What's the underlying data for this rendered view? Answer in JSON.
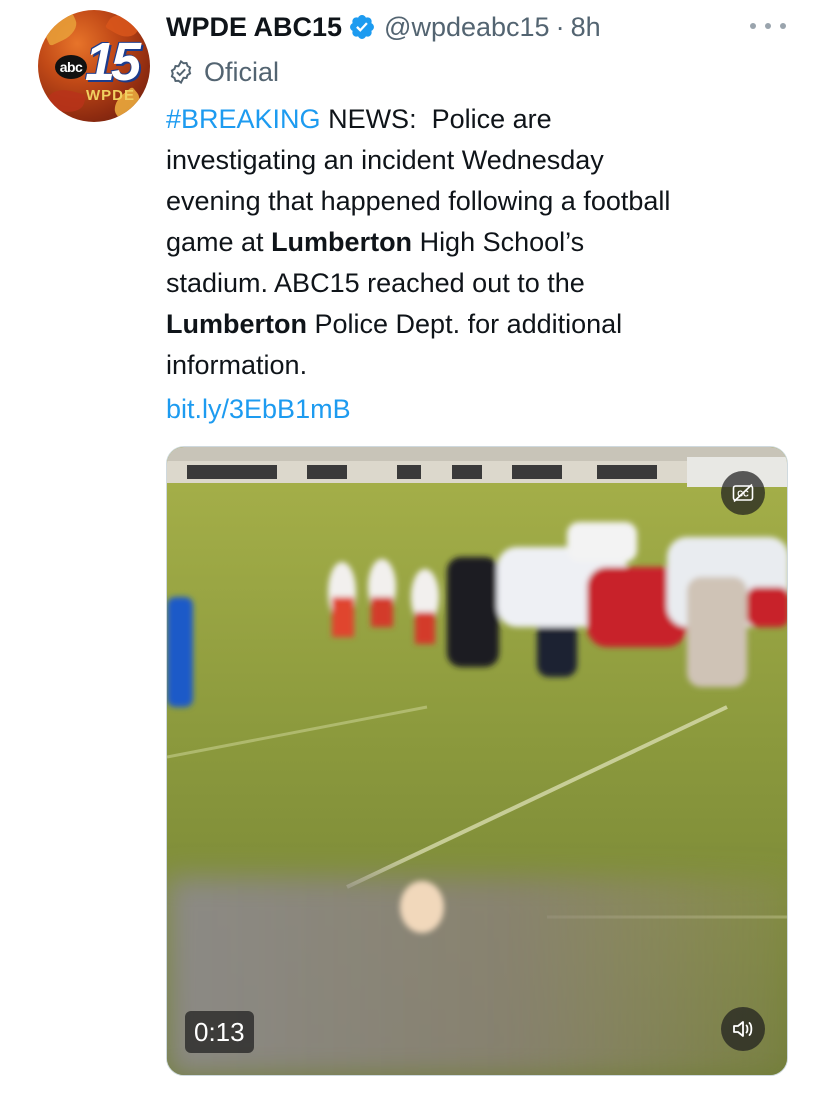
{
  "colors": {
    "text_primary": "#0f1419",
    "text_secondary": "#536471",
    "link": "#1d9bf0",
    "verified_badge": "#1d9bf0"
  },
  "author": {
    "avatar_logo_abc": "abc",
    "avatar_logo_number": "15",
    "avatar_logo_call": "WPDE",
    "display_name": "WPDE ABC15",
    "verified_icon": "verified-badge-icon",
    "handle": "@wpdeabc15",
    "separator": "·",
    "time_ago": "8h",
    "label_icon": "official-check-icon",
    "label": "Oficial"
  },
  "more_menu_icon": "more-dots-icon",
  "tweet": {
    "line1": {
      "hashtag": "#BREAKING",
      "rest": " NEWS:  Police are"
    },
    "line2": "investigating an incident Wednesday",
    "line3": "evening that happened following a football",
    "line4": {
      "before": "game at ",
      "bold": "Lumberton",
      "after": " High School’s"
    },
    "line5": "stadium. ABC15 reached out to the",
    "line6": {
      "bold": "Lumberton",
      "after": " Police Dept. for additional"
    },
    "line7": "information.",
    "short_link": "bit.ly/3EbB1mB"
  },
  "video": {
    "duration": "0:13",
    "captions_icon": "closed-captions-icon",
    "sound_icon": "volume-muted-icon"
  }
}
